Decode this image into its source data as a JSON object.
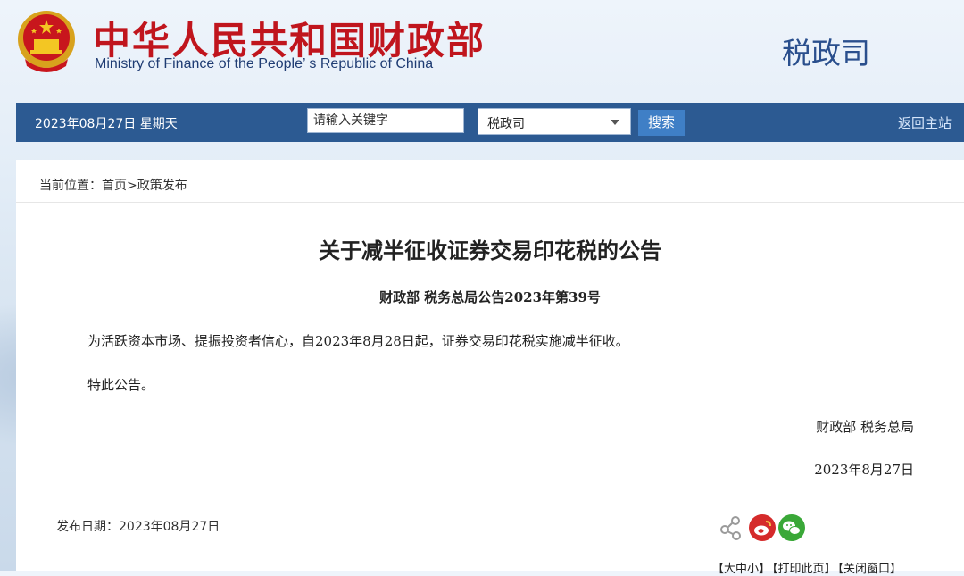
{
  "header": {
    "title_cn": "中华人民共和国财政部",
    "title_en": "Ministry of Finance of the People’ s Republic of China",
    "department": "税政司"
  },
  "navbar": {
    "date": "2023年08月27日  星期天",
    "search_placeholder": "请输入关键字",
    "select_value": "税政司",
    "search_button": "搜索",
    "home_link": "返回主站"
  },
  "breadcrumb": "当前位置：首页>政策发布",
  "article": {
    "title": "关于减半征收证券交易印花税的公告",
    "subtitle": "财政部  税务总局公告2023年第39号",
    "paragraphs": [
      "为活跃资本市场、提振投资者信心，自2023年8月28日起，证券交易印花税实施减半征收。",
      "特此公告。"
    ],
    "signature_org": "财政部    税务总局",
    "signature_date": "2023年8月27日"
  },
  "footer": {
    "publish_date": "发布日期：2023年08月27日",
    "share_icons": [
      "share-icon",
      "weibo-icon",
      "wechat-icon"
    ],
    "tools": [
      "【大中小】",
      "【打印此页】",
      "【关闭窗口】"
    ]
  },
  "colors": {
    "title_red": "#c0151d",
    "nav_blue": "#2c5a92",
    "button_blue": "#3f7fc6",
    "department_blue": "#2a4f8d"
  }
}
